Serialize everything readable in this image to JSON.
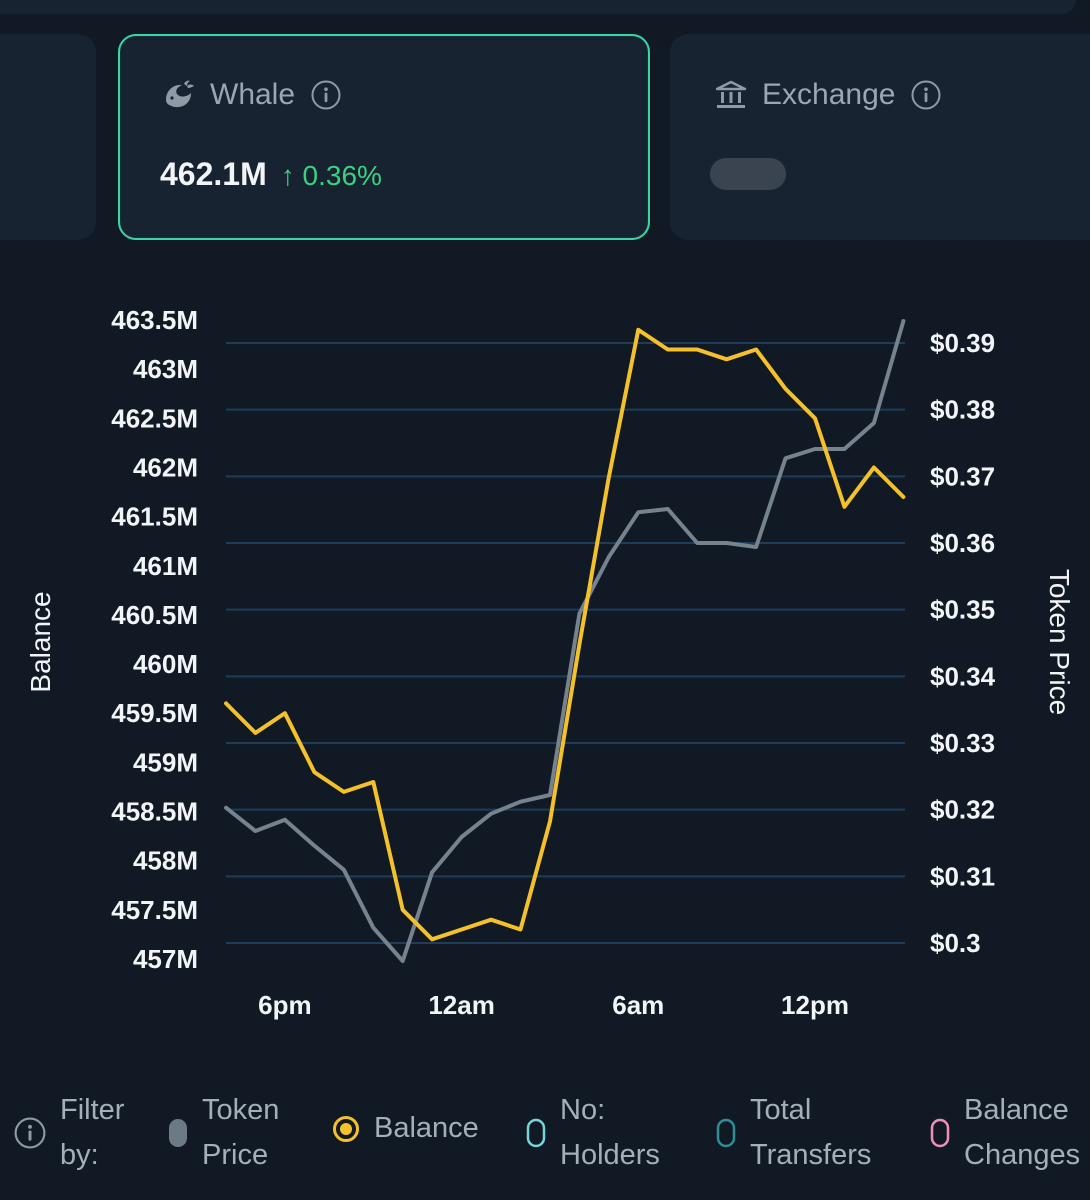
{
  "cards": {
    "whale": {
      "label": "Whale",
      "value": "462.1M",
      "change": "0.36%",
      "change_arrow": "↑",
      "accent": "#3ad6a4",
      "change_color": "#3ad17f"
    },
    "exchange": {
      "label": "Exchange"
    }
  },
  "chart_data": {
    "type": "line",
    "x": [
      "4pm",
      "5pm",
      "6pm",
      "7pm",
      "8pm",
      "9pm",
      "10pm",
      "11pm",
      "12am",
      "1am",
      "2am",
      "3am",
      "4am",
      "5am",
      "6am",
      "7am",
      "8am",
      "9am",
      "10am",
      "11am",
      "12pm",
      "1pm",
      "2pm",
      "3pm",
      "4pm"
    ],
    "x_tick_labels": [
      "6pm",
      "12am",
      "6am",
      "12pm"
    ],
    "y_tick_labels": [
      "463.5M",
      "463M",
      "462.5M",
      "462M",
      "461.5M",
      "461M",
      "460.5M",
      "460M",
      "459.5M",
      "459M",
      "458.5M",
      "458M",
      "457.5M",
      "457M"
    ],
    "y2_tick_labels": [
      "$0.39",
      "$0.38",
      "$0.37",
      "$0.36",
      "$0.35",
      "$0.34",
      "$0.33",
      "$0.32",
      "$0.31",
      "$0.3"
    ],
    "ylabel": "Balance",
    "y2label": "Token Price",
    "ylim": [
      457,
      463.5
    ],
    "y2lim": [
      0.3,
      0.39
    ],
    "grid": true,
    "series": [
      {
        "name": "Balance",
        "axis": "left",
        "color": "#f5c12a",
        "values": [
          459.6,
          459.3,
          459.5,
          458.9,
          458.7,
          458.8,
          457.5,
          457.2,
          457.3,
          457.4,
          457.3,
          458.4,
          460.2,
          461.9,
          463.4,
          463.2,
          463.2,
          463.1,
          463.2,
          462.8,
          462.5,
          461.6,
          462.0,
          461.7
        ]
      },
      {
        "name": "Token Price",
        "axis": "right",
        "color": "#76838f",
        "values": [
          0.3203,
          0.3168,
          0.3185,
          0.3146,
          0.311,
          0.3023,
          0.2973,
          0.3106,
          0.3159,
          0.3194,
          0.3212,
          0.3222,
          0.3494,
          0.3579,
          0.3646,
          0.3651,
          0.36,
          0.36,
          0.3594,
          0.3727,
          0.3741,
          0.3741,
          0.378,
          0.3933
        ]
      }
    ]
  },
  "legend": {
    "prefix": [
      "Filter",
      "by:"
    ],
    "items": [
      {
        "lines": [
          "Token",
          "Price"
        ],
        "color": "#6d7985",
        "style": "filled-pill"
      },
      {
        "lines": [
          "Balance"
        ],
        "color": "#f5c12a",
        "style": "ring-dot"
      },
      {
        "lines": [
          "No:",
          "Holders"
        ],
        "color": "#76d4dd",
        "style": "outline-pill"
      },
      {
        "lines": [
          "Total",
          "Transfers"
        ],
        "color": "#2d8f96",
        "style": "outline-pill"
      },
      {
        "lines": [
          "Balance",
          "Changes"
        ],
        "color": "#f08fb8",
        "style": "outline-pill"
      }
    ]
  },
  "icons": {
    "whale": "whale-icon",
    "exchange": "bank-icon",
    "info": "info-icon"
  }
}
